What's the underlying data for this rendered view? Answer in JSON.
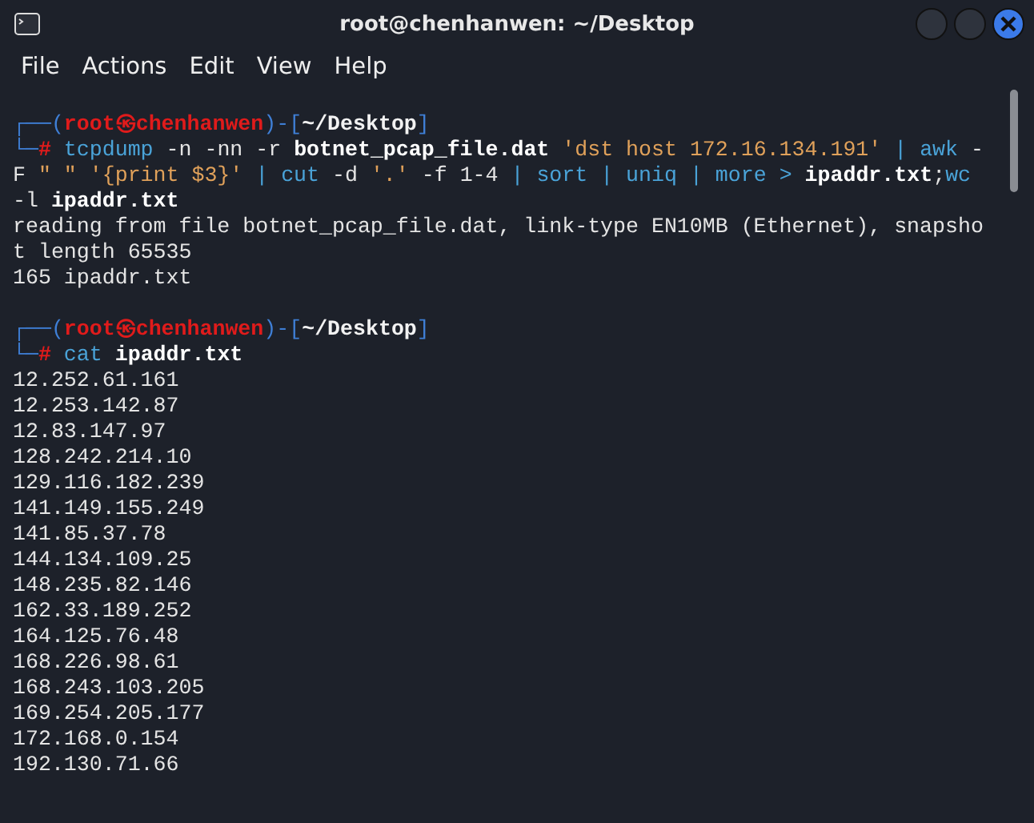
{
  "window": {
    "title": "root@chenhanwen: ~/Desktop"
  },
  "menu": [
    {
      "label": "File"
    },
    {
      "label": "Actions"
    },
    {
      "label": "Edit"
    },
    {
      "label": "View"
    },
    {
      "label": "Help"
    }
  ],
  "terminal": {
    "blocks": [
      {
        "lines": [
          {
            "segments": [
              {
                "kind": "frame",
                "text": "┌──("
              },
              {
                "kind": "user",
                "text": "root㉿chenhanwen"
              },
              {
                "kind": "frame",
                "text": ")-["
              },
              {
                "kind": "path",
                "text": "~/Desktop"
              },
              {
                "kind": "frame",
                "text": "]"
              }
            ]
          },
          {
            "segments": [
              {
                "kind": "frame",
                "text": "└─"
              },
              {
                "kind": "hash",
                "text": "#"
              },
              {
                "kind": "cmd",
                "text": " tcpdump"
              },
              {
                "kind": "plain",
                "text": " -n -nn -r "
              },
              {
                "kind": "bold",
                "text": "botnet_pcap_file.dat"
              },
              {
                "kind": "str",
                "text": " 'dst host 172.16.134.191'"
              },
              {
                "kind": "cmd",
                "text": " | awk"
              },
              {
                "kind": "plain",
                "text": " -"
              }
            ]
          },
          {
            "segments": [
              {
                "kind": "plain",
                "text": "F "
              },
              {
                "kind": "str",
                "text": "\" \" '{print $3}'"
              },
              {
                "kind": "cmd",
                "text": " | cut"
              },
              {
                "kind": "plain",
                "text": " -d "
              },
              {
                "kind": "str",
                "text": "'.'"
              },
              {
                "kind": "plain",
                "text": " -f 1-4"
              },
              {
                "kind": "cmd",
                "text": " | sort | uniq | more > "
              },
              {
                "kind": "bold",
                "text": "ipaddr.txt"
              },
              {
                "kind": "plain",
                "text": ";"
              },
              {
                "kind": "cmd",
                "text": "wc"
              }
            ]
          },
          {
            "segments": [
              {
                "kind": "plain",
                "text": "-l "
              },
              {
                "kind": "bold",
                "text": "ipaddr.txt"
              }
            ]
          },
          {
            "segments": [
              {
                "kind": "plain",
                "text": "reading from file botnet_pcap_file.dat, link-type EN10MB (Ethernet), snapsho"
              }
            ]
          },
          {
            "segments": [
              {
                "kind": "plain",
                "text": "t length 65535"
              }
            ]
          },
          {
            "segments": [
              {
                "kind": "plain",
                "text": "165 ipaddr.txt"
              }
            ]
          }
        ]
      },
      {
        "lines": [
          {
            "segments": [
              {
                "kind": "frame",
                "text": "┌──("
              },
              {
                "kind": "user",
                "text": "root㉿chenhanwen"
              },
              {
                "kind": "frame",
                "text": ")-["
              },
              {
                "kind": "path",
                "text": "~/Desktop"
              },
              {
                "kind": "frame",
                "text": "]"
              }
            ]
          },
          {
            "segments": [
              {
                "kind": "frame",
                "text": "└─"
              },
              {
                "kind": "hash",
                "text": "#"
              },
              {
                "kind": "cmd",
                "text": " cat"
              },
              {
                "kind": "bold",
                "text": " ipaddr.txt"
              }
            ]
          },
          {
            "segments": [
              {
                "kind": "plain",
                "text": "12.252.61.161"
              }
            ]
          },
          {
            "segments": [
              {
                "kind": "plain",
                "text": "12.253.142.87"
              }
            ]
          },
          {
            "segments": [
              {
                "kind": "plain",
                "text": "12.83.147.97"
              }
            ]
          },
          {
            "segments": [
              {
                "kind": "plain",
                "text": "128.242.214.10"
              }
            ]
          },
          {
            "segments": [
              {
                "kind": "plain",
                "text": "129.116.182.239"
              }
            ]
          },
          {
            "segments": [
              {
                "kind": "plain",
                "text": "141.149.155.249"
              }
            ]
          },
          {
            "segments": [
              {
                "kind": "plain",
                "text": "141.85.37.78"
              }
            ]
          },
          {
            "segments": [
              {
                "kind": "plain",
                "text": "144.134.109.25"
              }
            ]
          },
          {
            "segments": [
              {
                "kind": "plain",
                "text": "148.235.82.146"
              }
            ]
          },
          {
            "segments": [
              {
                "kind": "plain",
                "text": "162.33.189.252"
              }
            ]
          },
          {
            "segments": [
              {
                "kind": "plain",
                "text": "164.125.76.48"
              }
            ]
          },
          {
            "segments": [
              {
                "kind": "plain",
                "text": "168.226.98.61"
              }
            ]
          },
          {
            "segments": [
              {
                "kind": "plain",
                "text": "168.243.103.205"
              }
            ]
          },
          {
            "segments": [
              {
                "kind": "plain",
                "text": "169.254.205.177"
              }
            ]
          },
          {
            "segments": [
              {
                "kind": "plain",
                "text": "172.168.0.154"
              }
            ]
          },
          {
            "segments": [
              {
                "kind": "plain",
                "text": "192.130.71.66"
              }
            ]
          }
        ]
      }
    ]
  }
}
